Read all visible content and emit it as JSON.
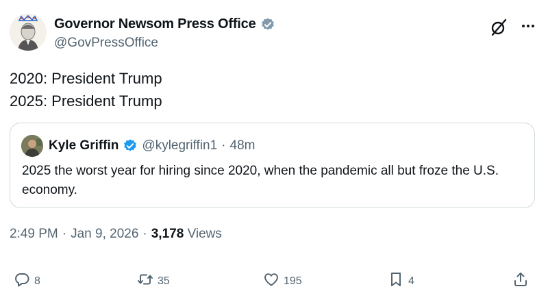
{
  "author": {
    "display_name": "Governor Newsom Press Office",
    "handle": "@GovPressOffice"
  },
  "tweet": {
    "lines": [
      "2020: President Trump",
      "2025: President Trump"
    ]
  },
  "quoted": {
    "display_name": "Kyle Griffin",
    "handle": "@kylegriffin1",
    "separator": "·",
    "time": "48m",
    "text": "2025 the worst year for hiring since 2020, when the pandemic all but froze the U.S. economy."
  },
  "meta": {
    "time": "2:49 PM",
    "sep1": "·",
    "date": "Jan 9, 2026",
    "sep2": "·",
    "views_count": "3,178",
    "views_label": "Views"
  },
  "actions": {
    "replies": "8",
    "reposts": "35",
    "likes": "195",
    "bookmarks": "4"
  },
  "icons": {
    "verified": "verified-badge-icon",
    "grok": "grok-icon",
    "more": "more-icon",
    "reply": "reply-icon",
    "repost": "repost-icon",
    "like": "heart-icon",
    "bookmark": "bookmark-icon",
    "share": "share-icon"
  },
  "colors": {
    "verified_blue": "#1d9bf0",
    "secondary_text": "#536471",
    "primary_text": "#0f1419",
    "border": "#cfd9de"
  }
}
